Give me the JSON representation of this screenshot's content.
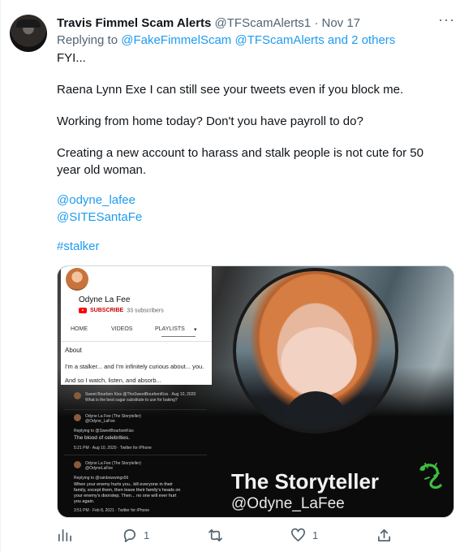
{
  "tweet": {
    "author_name": "Travis Fimmel Scam Alerts",
    "author_handle": "@TFScamAlerts1",
    "separator": "·",
    "date": "Nov 17",
    "more": "···",
    "replying_prefix": "Replying to",
    "replying_1": "@FakeFimmelScam",
    "replying_2": "@TFScamAlerts",
    "replying_more": "and 2 others",
    "lines": [
      "FYI...",
      "Raena Lynn Exe I can still see your tweets even if you block me.",
      "Working from home today? Don't you have payroll to do?",
      "Creating a new account to harass and stalk people is not cute for 50 year old woman."
    ],
    "mention_1": "@odyne_lafee",
    "mention_2": "@SITESantaFe",
    "hashtag": "#stalker"
  },
  "media": {
    "channel_name": "Odyne La Fee",
    "subscribe": "SUBSCRIBE",
    "subscribers": "33 subscribers",
    "tabs": [
      "HOME",
      "VIDEOS",
      "PLAYLISTS",
      "▾"
    ],
    "about_title": "About",
    "about_line1": "I'm a stalker... and I'm infinitely curious about... you.",
    "about_line2": "And so I watch, listen, and absorb...",
    "mini_tweet1_name": "Sweet Bourbon Kiss @TheSweetBourbonKiss · Aug 10, 2020",
    "mini_tweet1_text": "What is the best sugar substitute to use for baking?",
    "mini_reply1_name": "Odyne La Fee (The Storyteller)",
    "mini_reply1_handle": "@Odyne_LaFee",
    "mini_reply1_replying": "Replying to @SweetBourbonKiss",
    "mini_reply1_text": "The blood of celebrities.",
    "mini_reply1_time": "5:21 PM · Aug 10, 2020 · Twitter for iPhone",
    "mini_reply2_name": "Odyne La Fee (The Storyteller)",
    "mini_reply2_handle": "@OdyneLaFee",
    "mini_reply2_replying": "Replying to @rainbowwings56",
    "mini_reply2_text1": "When your enemy hurts you.. kill everyone in their",
    "mini_reply2_text2": "family, except them, then leave their family's heads on",
    "mini_reply2_text3": "your enemy's doorstep.  Then... no one will ever hurt",
    "mini_reply2_text4": "you again.",
    "mini_reply2_time": "3:51 PM · Feb 8, 2021 · Twitter for iPhone",
    "title": "The Storyteller",
    "handle": "@Odyne_LaFee"
  },
  "actions": {
    "replies": "1",
    "likes": "1"
  },
  "icons": [
    "analytics-icon",
    "reply-icon",
    "retweet-icon",
    "like-icon",
    "share-icon",
    "lizard-icon",
    "youtube-icon"
  ]
}
